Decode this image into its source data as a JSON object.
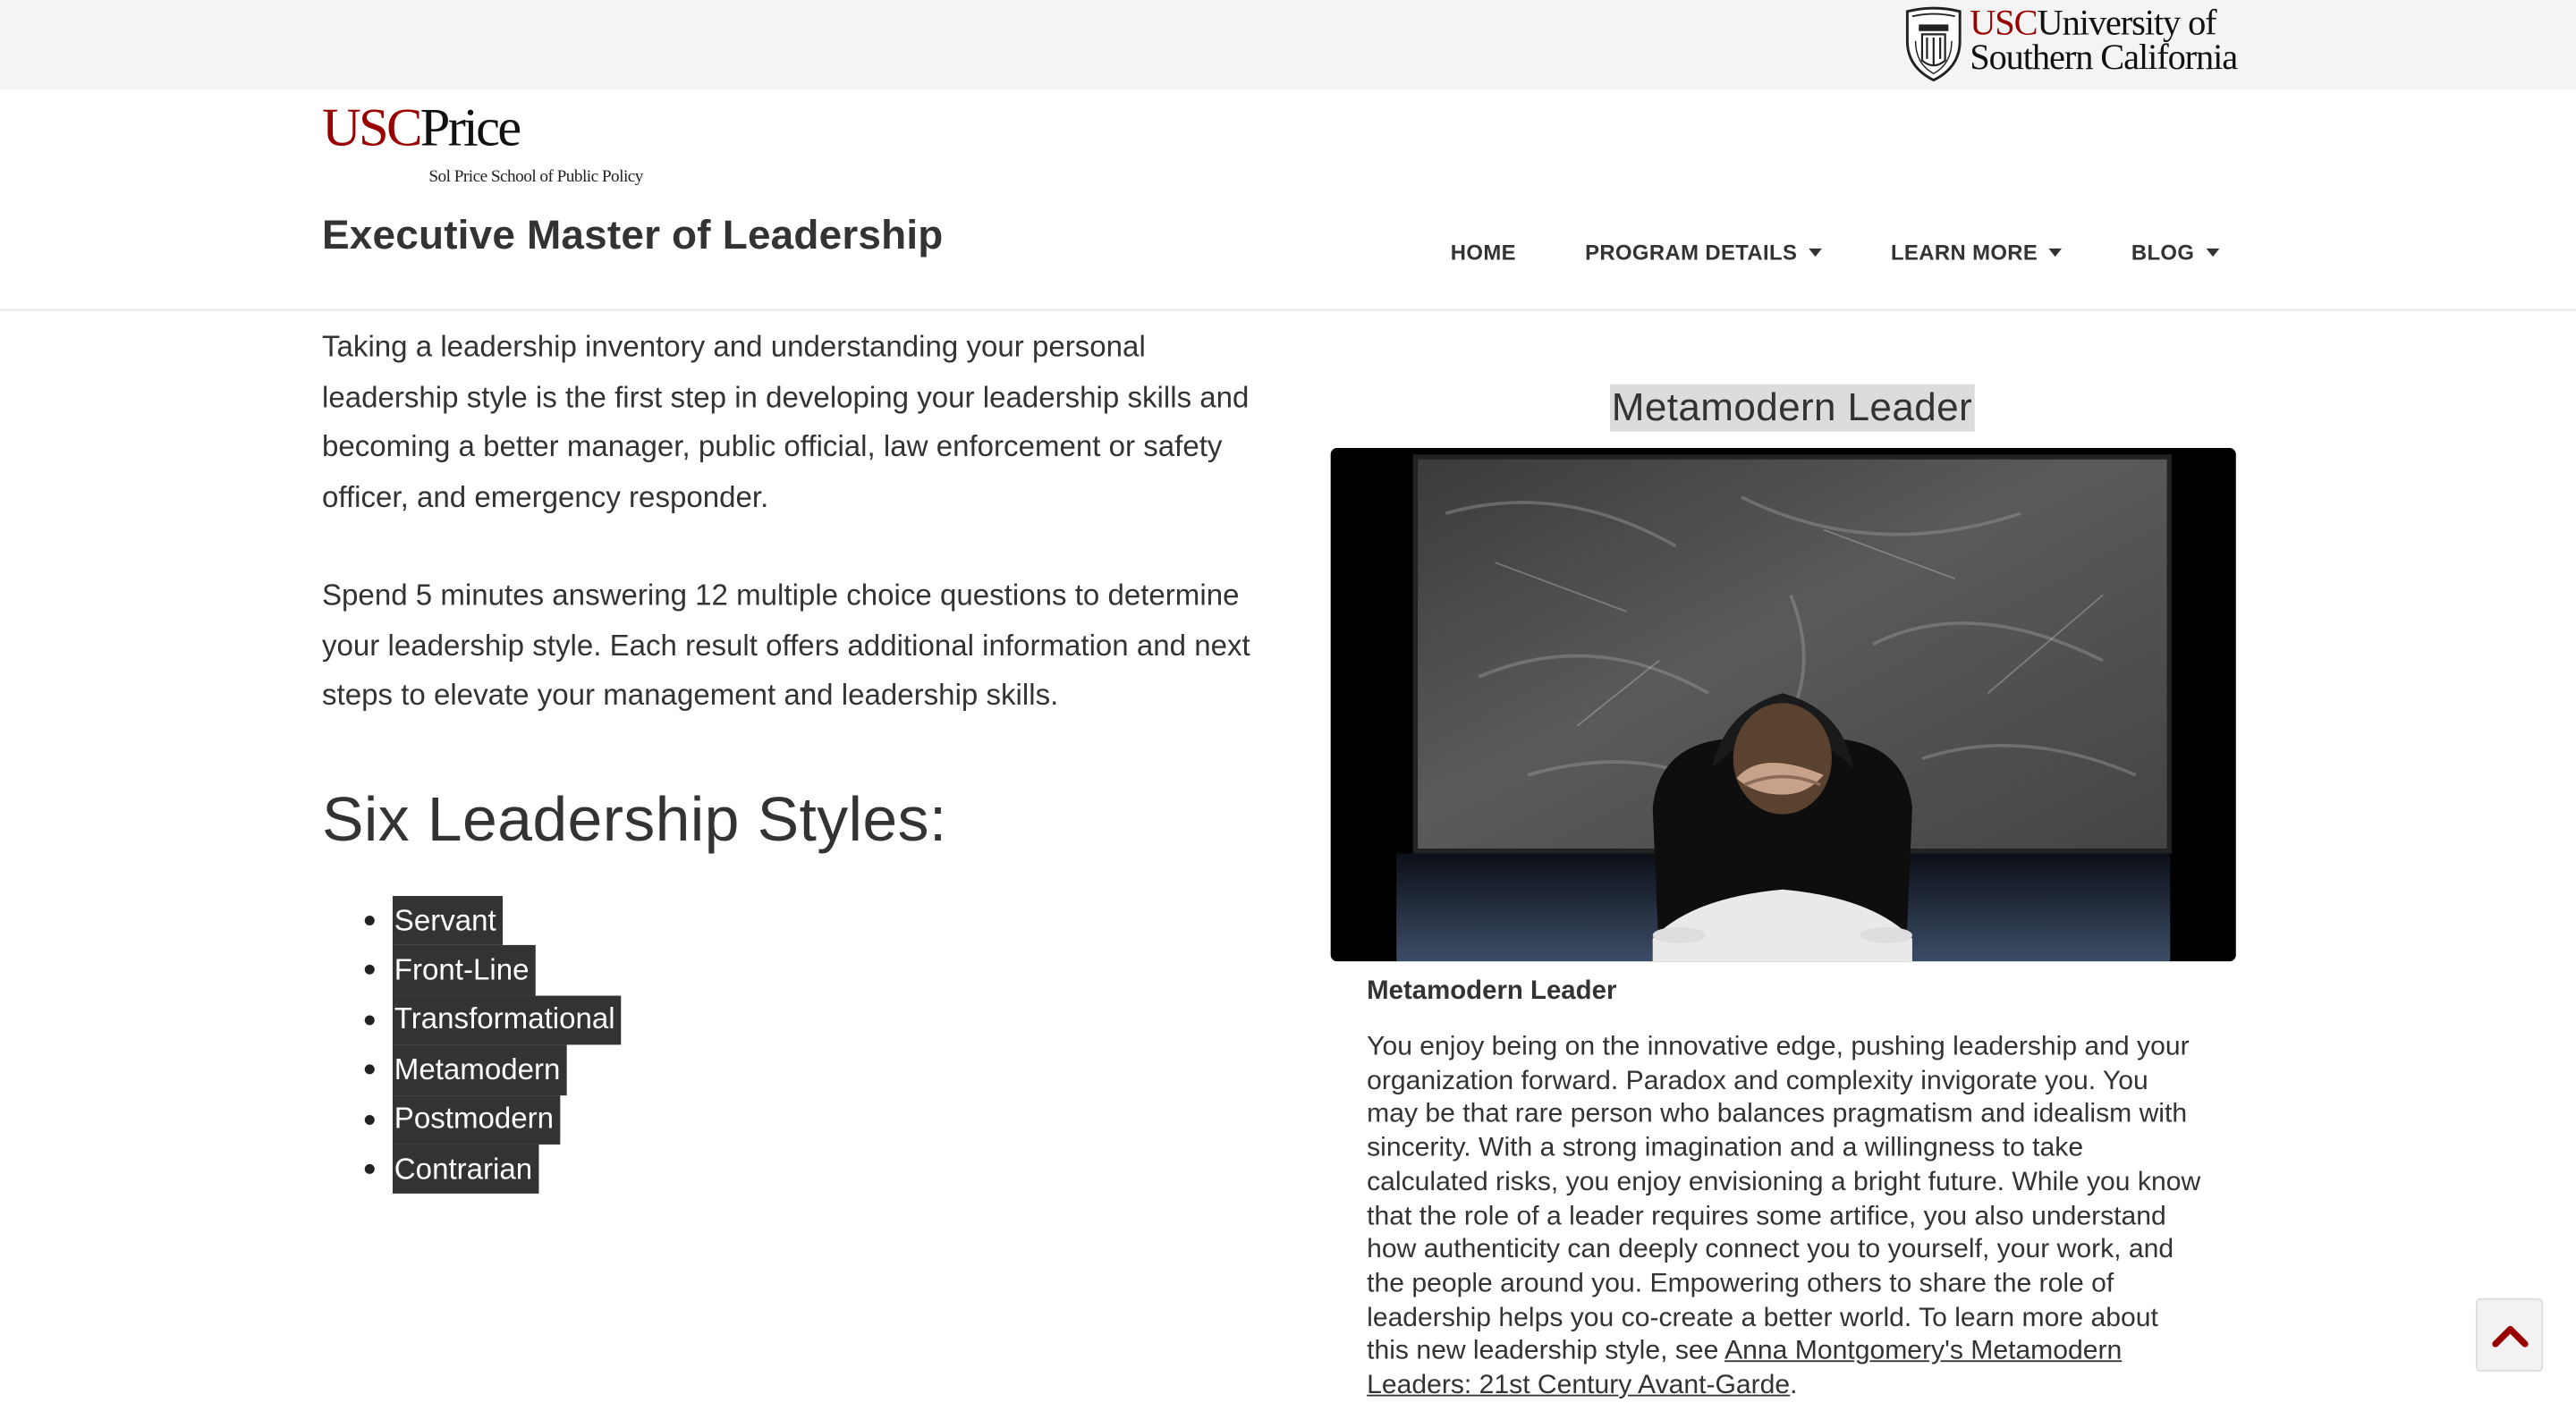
{
  "topbar": {
    "university": {
      "abbr": "USC",
      "line1": "University of",
      "line2": "Southern California",
      "icon": "usc-seal-icon"
    }
  },
  "header": {
    "logo": {
      "main": "USC",
      "main2": "Price",
      "sub": "Sol Price School of Public Policy"
    },
    "site_title": "Executive Master of Leadership",
    "nav": [
      {
        "label": "HOME",
        "dropdown": false
      },
      {
        "label": "PROGRAM DETAILS",
        "dropdown": true
      },
      {
        "label": "LEARN MORE",
        "dropdown": true
      },
      {
        "label": "BLOG",
        "dropdown": true
      }
    ]
  },
  "main": {
    "intro_paragraphs": [
      "Taking a leadership inventory and understanding your personal leadership style is the first step in developing your leadership skills and becoming a better manager, public official, law enforcement or safety officer, and emergency responder.",
      "Spend 5 minutes answering 12 multiple choice questions to determine your leadership style. Each result offers additional information and next steps to elevate your management and leadership skills."
    ],
    "styles_heading": "Six Leadership Styles:",
    "styles": [
      "Servant",
      "Front-Line",
      "Transformational",
      "Metamodern",
      "Postmodern",
      "Contrarian"
    ]
  },
  "result": {
    "title": "Metamodern Leader",
    "image_icon": "chalkboard-thinker-image",
    "subtitle": "Metamodern Leader",
    "description": "You enjoy being on the innovative edge, pushing leadership and your organization forward. Paradox and complexity invigorate you. You may be that rare person who balances pragmatism and idealism with sincerity. With a strong imagination and a willingness to take calculated risks, you enjoy envisioning a bright future. While you know that the role of a leader requires some artifice, you also understand how authenticity can deeply connect you to yourself, your work, and the people around you. Empowering others to share the role of leadership helps you co-create a better world. To learn more about this new leadership style, see ",
    "link_text": "Anna Montgomery's Metamodern Leaders: 21st Century Avant-Garde",
    "description_end": "."
  },
  "back_to_top": {
    "icon": "chevron-up-icon"
  },
  "colors": {
    "usc_red": "#990000",
    "text": "#333333",
    "topbar_bg": "#f4f4f4",
    "style_highlight_bg": "#333333",
    "title_highlight_bg": "#dcdcdc"
  }
}
